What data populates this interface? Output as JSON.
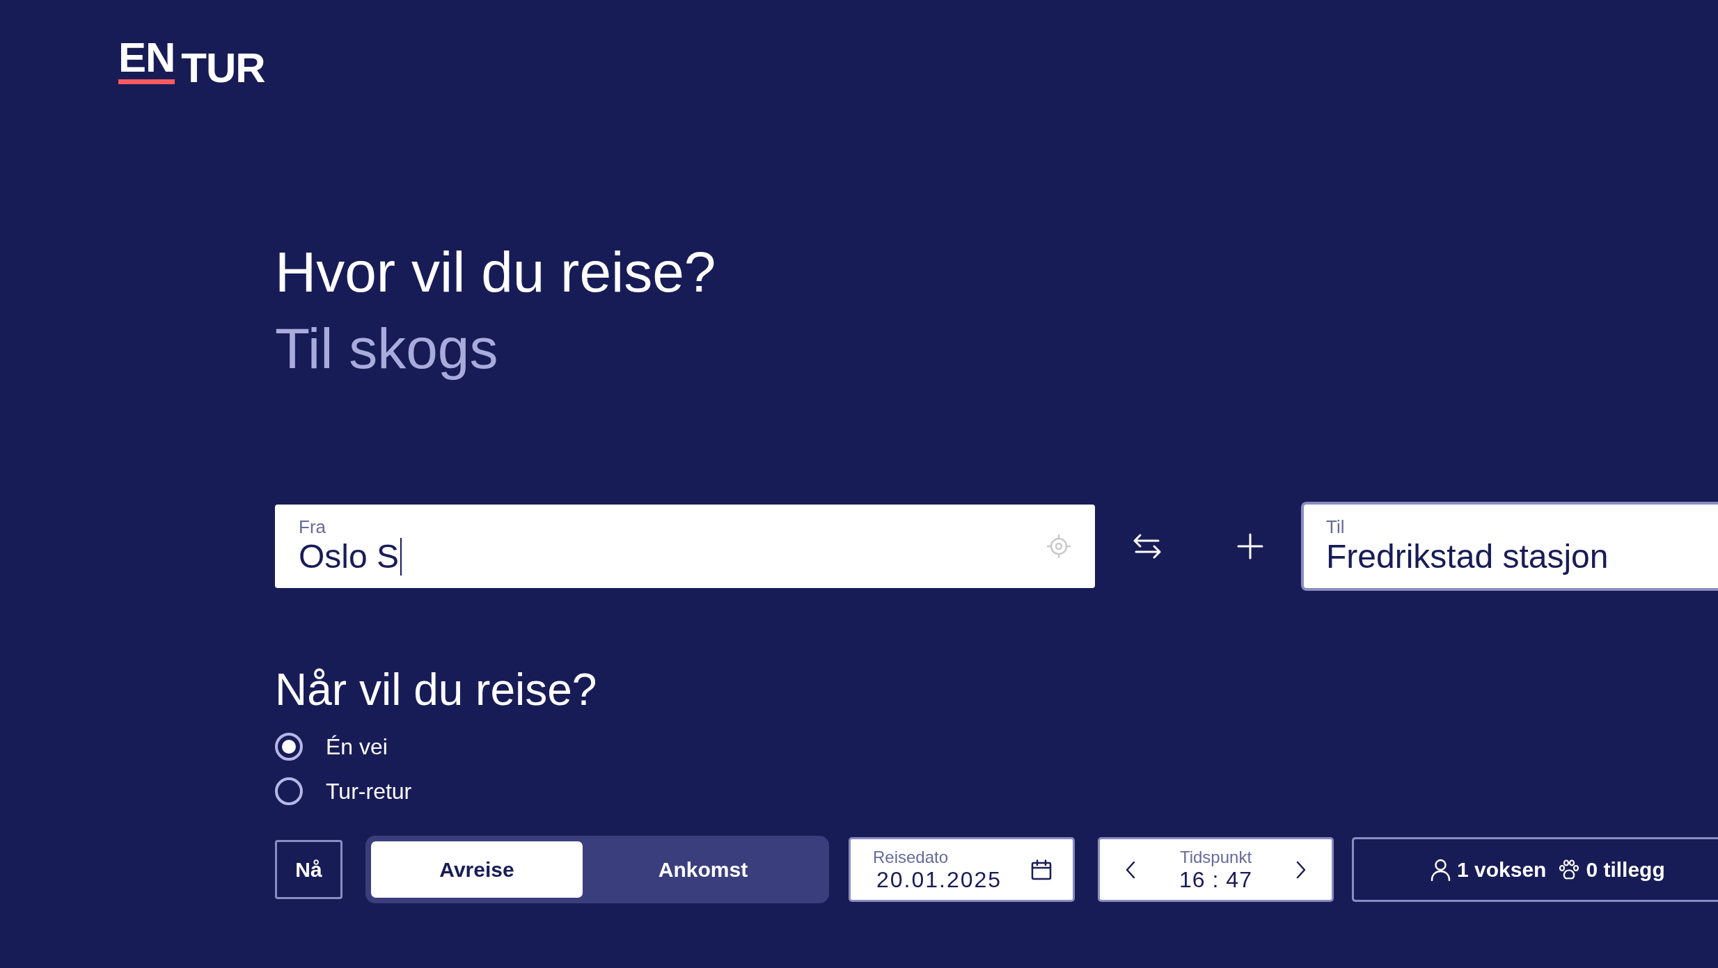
{
  "logo": {
    "upper": "EN",
    "lower": "TUR"
  },
  "heading": {
    "title": "Hvor vil du reise?",
    "subtitle": "Til skogs"
  },
  "from_field": {
    "label": "Fra",
    "value": "Oslo S",
    "focused": true
  },
  "to_field": {
    "label": "Til",
    "value": "Fredrikstad stasjon",
    "focused": false
  },
  "when": {
    "title": "Når vil du reise?",
    "trip_types": [
      {
        "label": "Én vei",
        "selected": true
      },
      {
        "label": "Tur-retur",
        "selected": false
      }
    ],
    "now_button": "Nå",
    "time_modes": [
      {
        "label": "Avreise",
        "selected": true
      },
      {
        "label": "Ankomst",
        "selected": false
      }
    ],
    "date_field": {
      "label": "Reisedato",
      "value": "20.01.2025"
    },
    "time_field": {
      "label": "Tidspunkt",
      "value": "16 : 47"
    },
    "travellers": {
      "adults": "1 voksen",
      "extras": "0 tillegg"
    }
  }
}
